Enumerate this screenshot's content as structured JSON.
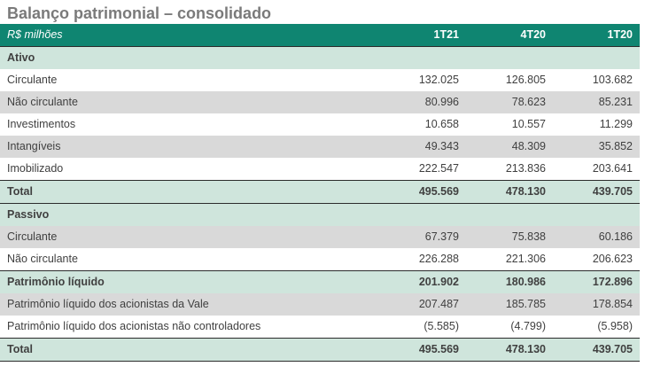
{
  "title": "Balanço patrimonial – consolidado",
  "header": {
    "label": "R$ milhões",
    "cols": [
      "1T21",
      "4T20",
      "1T20"
    ]
  },
  "rows": [
    {
      "label": "Ativo",
      "values": [
        "",
        "",
        ""
      ]
    },
    {
      "label": "Circulante",
      "values": [
        "132.025",
        "126.805",
        "103.682"
      ]
    },
    {
      "label": "Não circulante",
      "values": [
        "80.996",
        "78.623",
        "85.231"
      ]
    },
    {
      "label": "Investimentos",
      "values": [
        "10.658",
        "10.557",
        "11.299"
      ]
    },
    {
      "label": "Intangíveis",
      "values": [
        "49.343",
        "48.309",
        "35.852"
      ]
    },
    {
      "label": "Imobilizado",
      "values": [
        "222.547",
        "213.836",
        "203.641"
      ]
    },
    {
      "label": "Total",
      "values": [
        "495.569",
        "478.130",
        "439.705"
      ]
    },
    {
      "label": "Passivo",
      "values": [
        "",
        "",
        ""
      ]
    },
    {
      "label": "Circulante",
      "values": [
        "67.379",
        "75.838",
        "60.186"
      ]
    },
    {
      "label": "Não circulante",
      "values": [
        "226.288",
        "221.306",
        "206.623"
      ]
    },
    {
      "label": "Patrimônio líquido",
      "values": [
        "201.902",
        "180.986",
        "172.896"
      ]
    },
    {
      "label": "Patrimônio líquido dos acionistas da Vale",
      "values": [
        "207.487",
        "185.785",
        "178.854"
      ]
    },
    {
      "label": "Patrimônio líquido dos acionistas não controladores",
      "values": [
        "(5.585)",
        "(4.799)",
        "(5.958)"
      ]
    },
    {
      "label": "Total",
      "values": [
        "495.569",
        "478.130",
        "439.705"
      ]
    }
  ]
}
